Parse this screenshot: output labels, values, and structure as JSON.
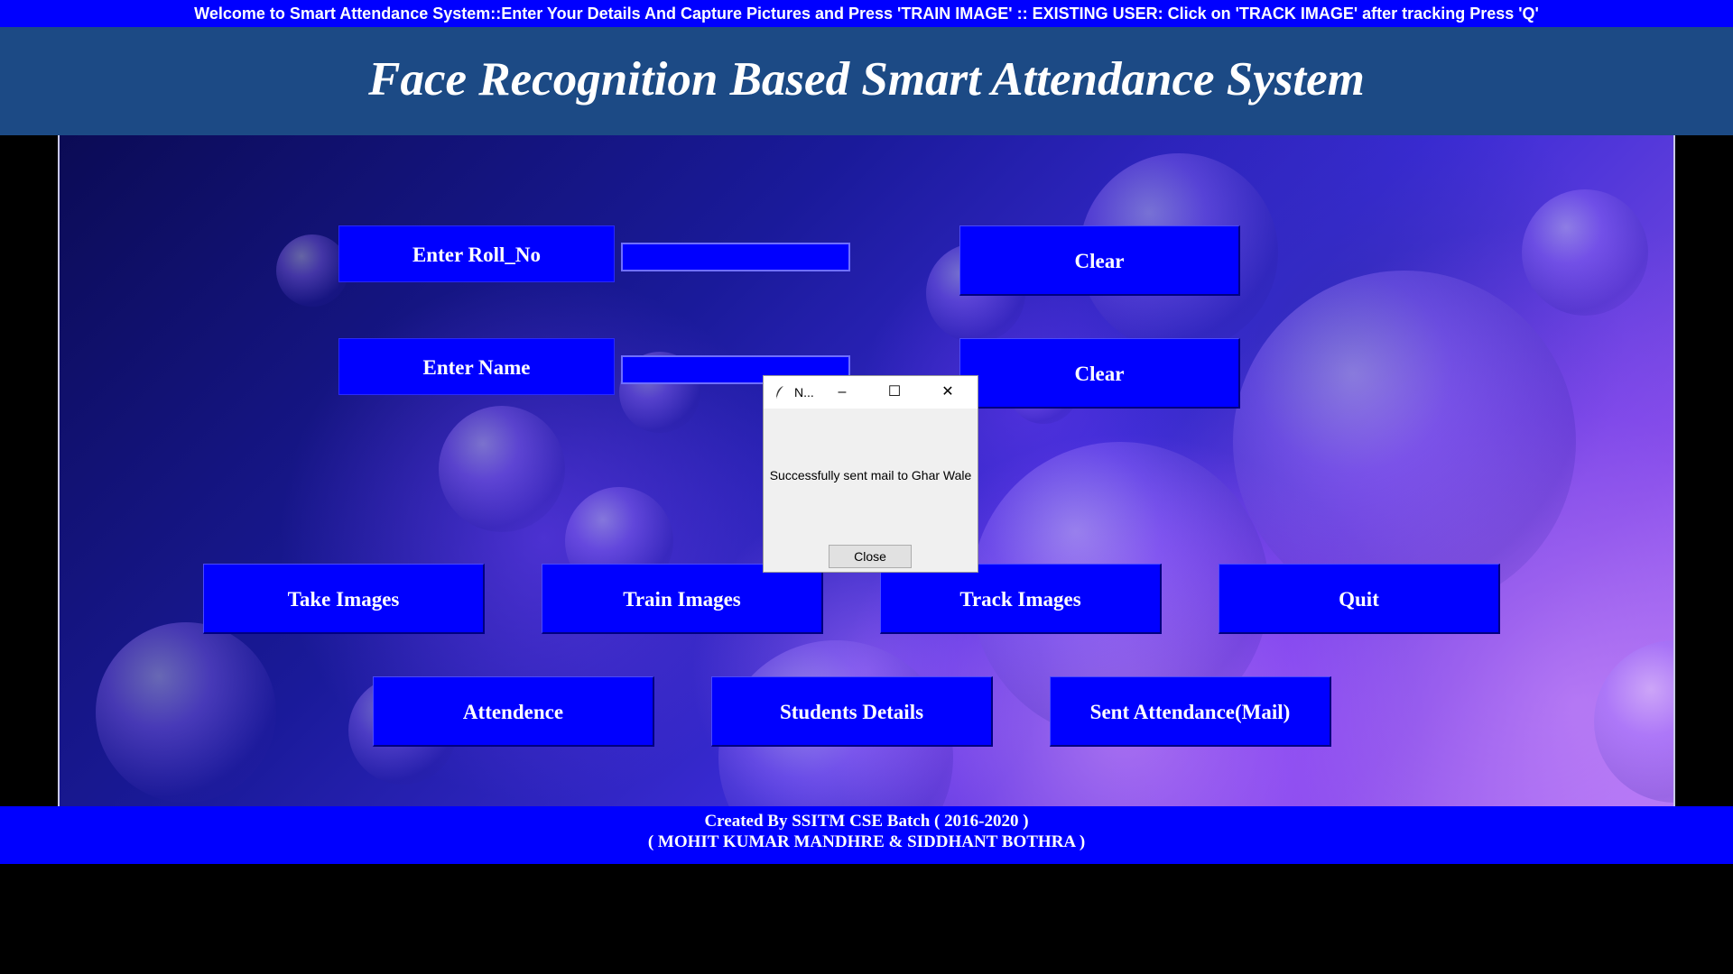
{
  "marquee_text": "Welcome to Smart Attendance System::Enter Your Details And Capture Pictures and Press 'TRAIN IMAGE' :: EXISTING USER: Click on 'TRACK IMAGE' after tracking Press 'Q'",
  "title": "Face Recognition Based Smart Attendance System",
  "form": {
    "roll_label": "Enter Roll_No",
    "roll_value": "",
    "name_label": "Enter Name",
    "name_value": "",
    "clear_roll": "Clear",
    "clear_name": "Clear"
  },
  "actions": {
    "take_images": "Take Images",
    "train_images": "Train Images",
    "track_images": "Track Images",
    "quit": "Quit",
    "attendence": "Attendence",
    "students_details": "Students Details",
    "sent_attendance": "Sent Attendance(Mail)"
  },
  "footer": {
    "line1": "Created By SSITM CSE Batch ( 2016-2020 )",
    "line2": "( MOHIT KUMAR MANDHRE & SIDDHANT BOTHRA )"
  },
  "dialog": {
    "title": "N...",
    "message": "Successfully sent mail to Ghar Wale",
    "close_label": "Close",
    "icons": [
      "feather-icon",
      "minimize-icon",
      "maximize-icon",
      "close-icon"
    ]
  },
  "colors": {
    "button_blue": "#0000ff",
    "title_bar": "#1c4a85",
    "text": "#ffffff"
  }
}
